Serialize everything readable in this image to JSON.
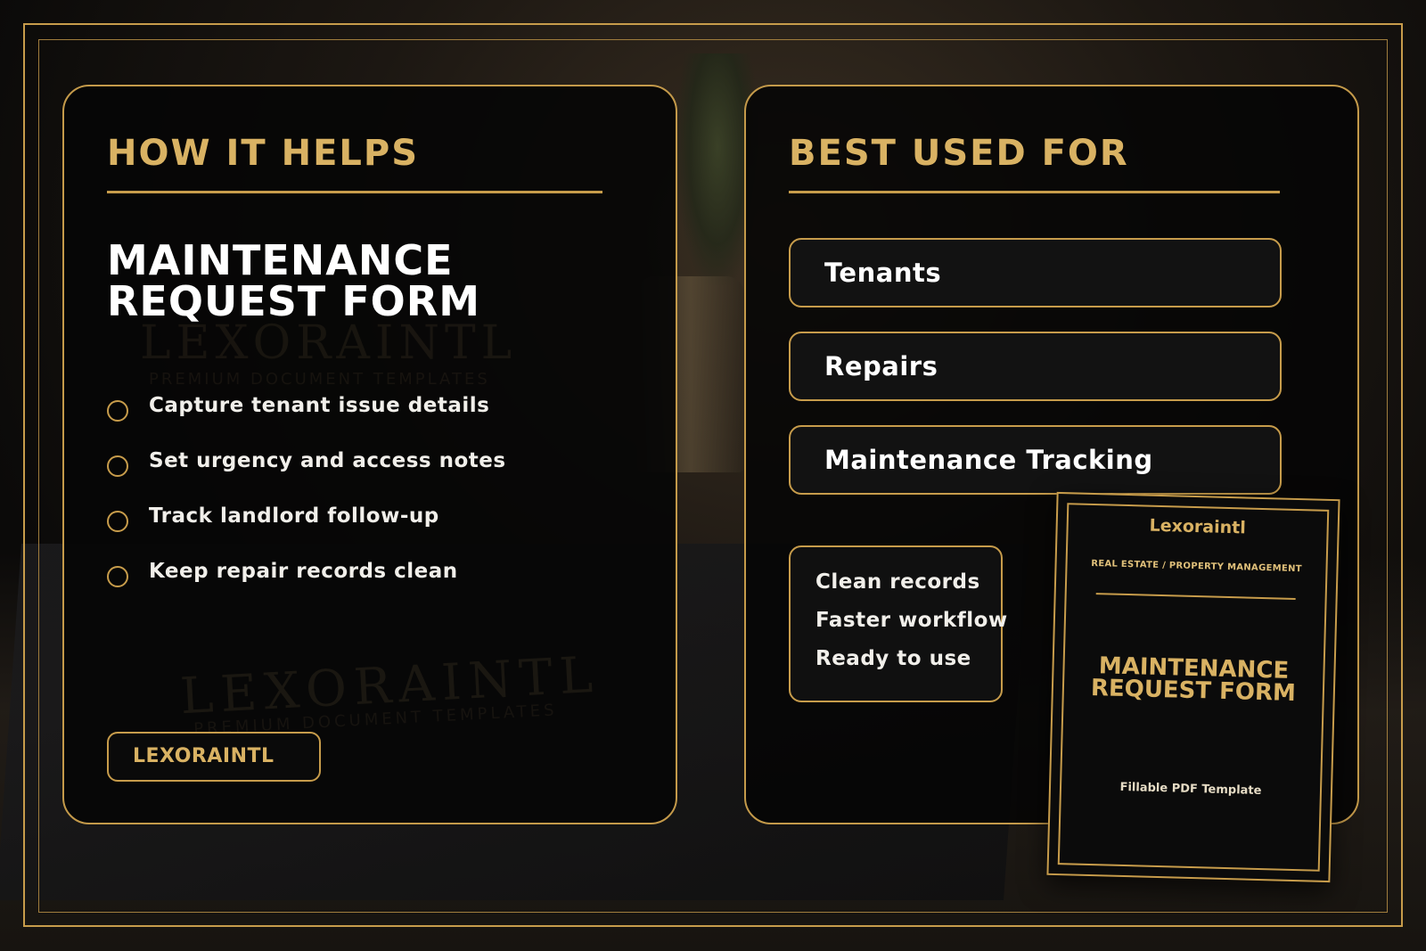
{
  "left_card": {
    "heading": "HOW IT HELPS",
    "title_line1": "MAINTENANCE",
    "title_line2": "REQUEST FORM",
    "benefits": [
      "Capture tenant issue details",
      "Set urgency and access notes",
      "Track landlord follow-up",
      "Keep repair records clean"
    ],
    "brand_badge": "LEXORAINTL",
    "watermark": "LEXORAINTL",
    "watermark_sub": "PREMIUM DOCUMENT TEMPLATES"
  },
  "right_card": {
    "heading": "BEST USED FOR",
    "uses": [
      "Tenants",
      "Repairs",
      "Maintenance Tracking"
    ],
    "perks": [
      "Clean records",
      "Faster workflow",
      "Ready to use"
    ]
  },
  "mockup": {
    "brand": "Lexoraintl",
    "category": "REAL ESTATE / PROPERTY MANAGEMENT",
    "title_line1": "MAINTENANCE",
    "title_line2": "REQUEST FORM",
    "footer": "Fillable PDF Template"
  },
  "colors": {
    "accent_gold": "#c79c4b",
    "heading_gold": "#d9b263",
    "card_bg": "#050505",
    "text_white": "#ffffff"
  }
}
